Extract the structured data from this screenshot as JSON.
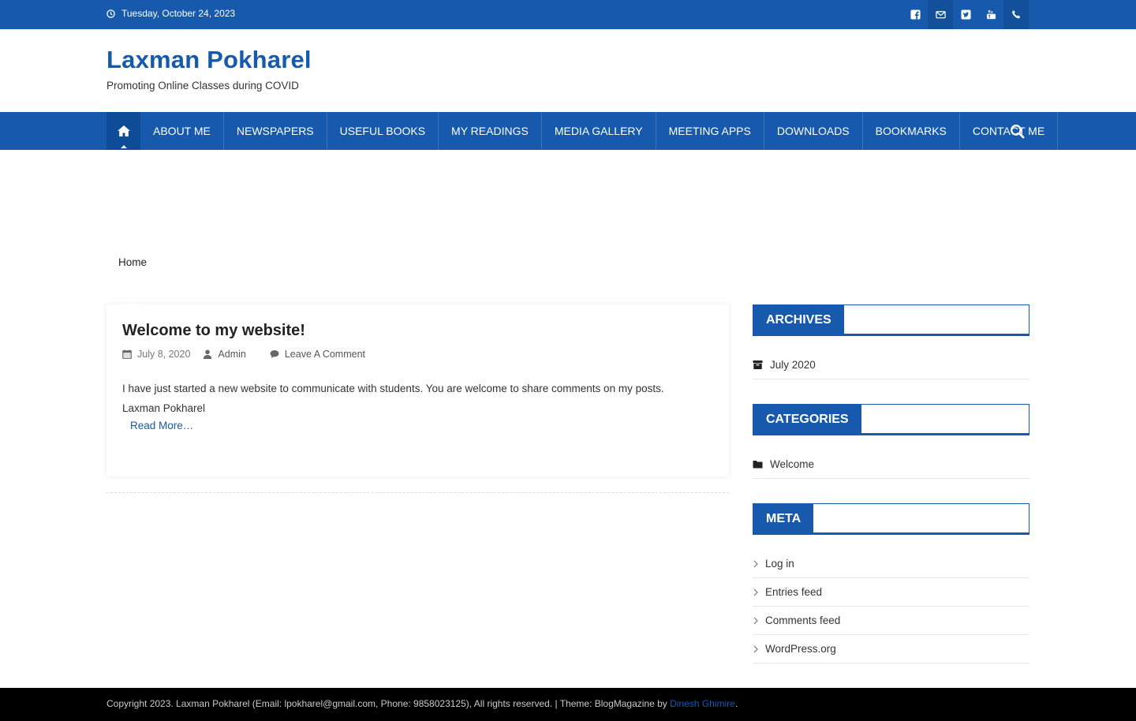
{
  "topbar": {
    "date": "Tuesday, October 24, 2023",
    "social_icons": [
      "facebook-icon",
      "email-icon",
      "twitter-icon",
      "youtube-icon",
      "phone-icon"
    ]
  },
  "header": {
    "site_title": "Laxman Pokharel",
    "site_description": "Promoting Online Classes during COVID"
  },
  "nav": {
    "items": [
      {
        "label": "About Me"
      },
      {
        "label": "Newspapers"
      },
      {
        "label": "Useful Books"
      },
      {
        "label": "My Readings"
      },
      {
        "label": "Media Gallery"
      },
      {
        "label": "Meeting Apps"
      },
      {
        "label": "Downloads"
      },
      {
        "label": "Bookmarks"
      },
      {
        "label": "Contact Me"
      }
    ]
  },
  "breadcrumb": {
    "home": "Home"
  },
  "post": {
    "title": "Welcome to my website!",
    "date": "July 8, 2020",
    "author": "Admin",
    "comment_link": "Leave A Comment",
    "excerpt_line1": "I have just started a new website to communicate with students. You are welcome to share comments on my posts.",
    "excerpt_line2": "Laxman Pokharel",
    "read_more": "Read More…"
  },
  "sidebar": {
    "archives": {
      "title": "Archives",
      "items": [
        "July 2020"
      ]
    },
    "categories": {
      "title": "Categories",
      "items": [
        "Welcome"
      ]
    },
    "meta": {
      "title": "Meta",
      "items": [
        "Log in",
        "Entries feed",
        "Comments feed",
        "WordPress.org"
      ]
    }
  },
  "footer": {
    "copyright": "Copyright 2023. Laxman Pokharel (Email: lpokharel@gmail.com, Phone: 9858023125), All rights reserved. | Theme: BlogMagazine by ",
    "author_link": "Dinesh Ghimire",
    "end": "."
  },
  "colors": {
    "brand": "#1659ad",
    "footer": "#000000"
  }
}
